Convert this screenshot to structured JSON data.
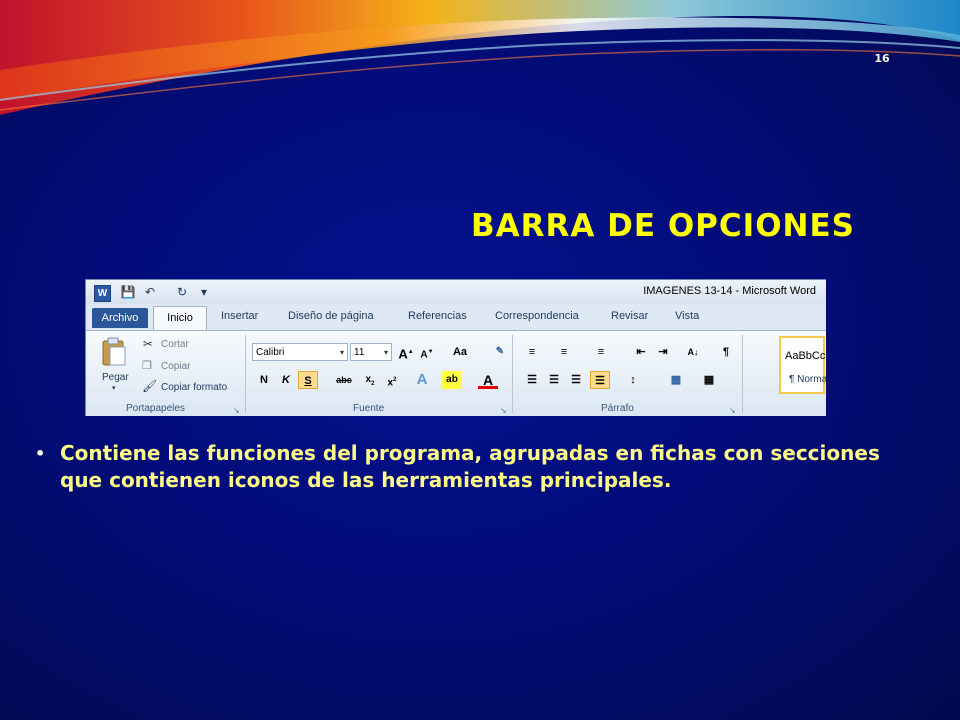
{
  "slide": {
    "page_number": "16",
    "title": "BARRA DE OPCIONES",
    "bullet": "Contiene las funciones del programa, agrupadas en fichas con secciones que contienen iconos de las herramientas principales.",
    "colors": {
      "background": "#020c7a",
      "title": "#ffff00",
      "bullet": "#fffd87"
    }
  },
  "ribbon": {
    "window_title": "IMAGENES 13-14  -  Microsoft Word",
    "tabs": [
      "Archivo",
      "Inicio",
      "Insertar",
      "Diseño de página",
      "Referencias",
      "Correspondencia",
      "Revisar",
      "Vista"
    ],
    "active_tab": "Inicio",
    "portapapeles": {
      "label": "Portapapeles",
      "paste": "Pegar",
      "cut": "Cortar",
      "copy": "Copiar",
      "format_painter": "Copiar formato"
    },
    "fuente": {
      "label": "Fuente",
      "font_name": "Calibri",
      "font_size": "11",
      "bold": "N",
      "italic": "K",
      "underline": "S",
      "strike": "abc",
      "change_case": "Aa"
    },
    "parrafo": {
      "label": "Párrafo",
      "pilcrow": "¶"
    },
    "estilos": {
      "preview": "AaBbCcDc",
      "normal": "¶ Normal"
    }
  }
}
